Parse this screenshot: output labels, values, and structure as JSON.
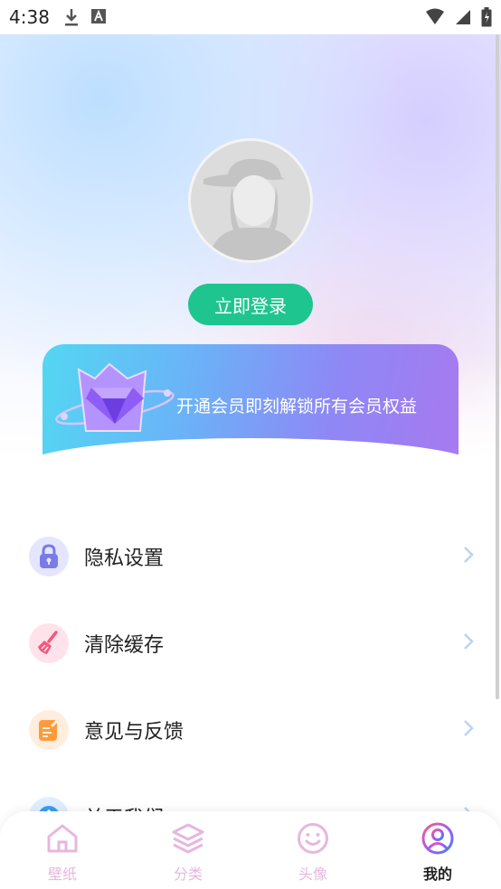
{
  "status_bar": {
    "time": "4:38"
  },
  "profile": {
    "login_label": "立即登录"
  },
  "vip_banner": {
    "text": "开通会员即刻解锁所有会员权益"
  },
  "menu": {
    "items": [
      {
        "label": "隐私设置",
        "icon": "lock-icon",
        "color": "#7a7be8",
        "bg": "#e4e6ff"
      },
      {
        "label": "清除缓存",
        "icon": "broom-icon",
        "color": "#f05a7e",
        "bg": "#ffe2ea"
      },
      {
        "label": "意见与反馈",
        "icon": "feedback-icon",
        "color": "#ff9a3c",
        "bg": "#ffeedd"
      },
      {
        "label": "关于我们",
        "icon": "info-icon",
        "color": "#3b9cf5",
        "bg": "#e0efff"
      }
    ]
  },
  "tabbar": {
    "tabs": [
      {
        "label": "壁纸",
        "icon": "home-icon"
      },
      {
        "label": "分类",
        "icon": "layers-icon"
      },
      {
        "label": "头像",
        "icon": "smile-icon"
      },
      {
        "label": "我的",
        "icon": "user-icon"
      }
    ],
    "active_index": 3
  },
  "colors": {
    "accent_green": "#1fc58e",
    "tab_inactive": "#e6b7df"
  }
}
